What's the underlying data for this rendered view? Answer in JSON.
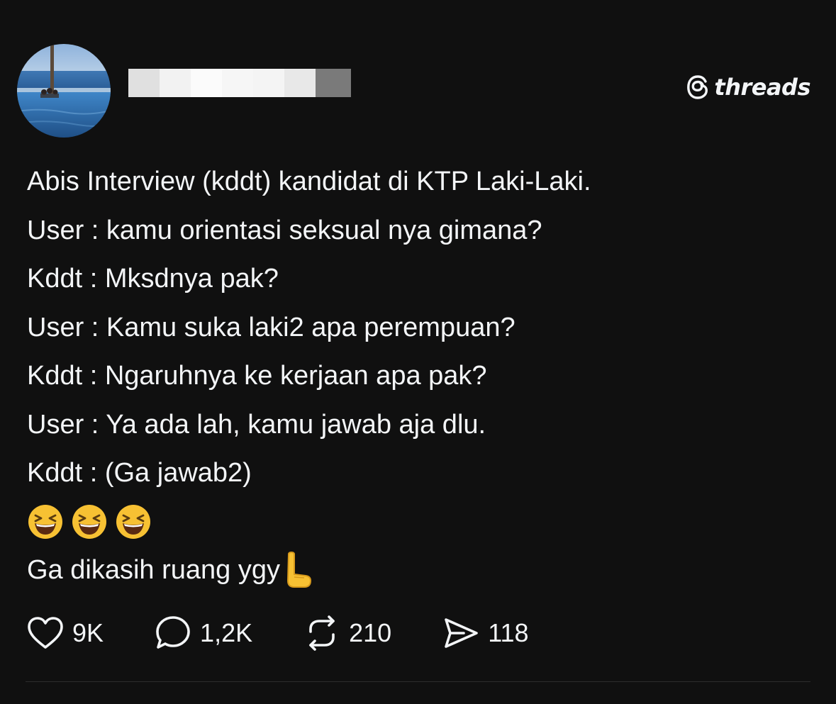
{
  "brand": {
    "name": "threads",
    "icon": "threads-logo-icon"
  },
  "author": {
    "avatar": "beach-photo-avatar",
    "username_redacted": true
  },
  "post": {
    "lines": [
      "Abis Interview (kddt) kandidat di KTP Laki-Laki.",
      "User : kamu orientasi seksual nya gimana?",
      "Kddt : Mksdnya pak?",
      "User : Kamu suka laki2 apa perempuan?",
      "Kddt : Ngaruhnya ke kerjaan apa pak?",
      "User : Ya ada lah, kamu jawab aja dlu.",
      "Kddt : (Ga jawab2)"
    ],
    "emojis": [
      "laughing-face-emoji",
      "laughing-face-emoji",
      "laughing-face-emoji"
    ],
    "closing": "Ga dikasih ruang ygy",
    "closing_emoji": "hand-gesture-emoji"
  },
  "actions": {
    "likes": {
      "count": "9K",
      "icon": "heart-icon"
    },
    "replies": {
      "count": "1,2K",
      "icon": "comment-icon"
    },
    "reposts": {
      "count": "210",
      "icon": "repost-icon"
    },
    "shares": {
      "count": "118",
      "icon": "send-icon"
    }
  },
  "colors": {
    "background": "#101010",
    "text": "#f3f5f7",
    "divider": "#2c2c2c",
    "emoji_yellow": "#f7c133"
  }
}
